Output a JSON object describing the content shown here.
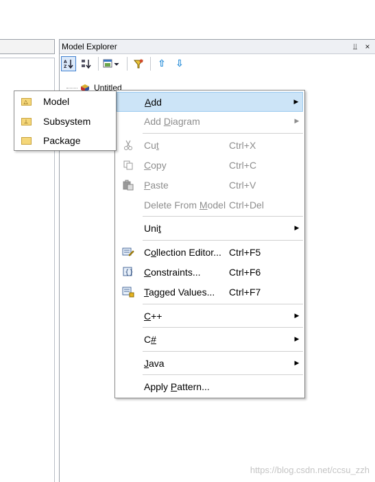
{
  "panel": {
    "title": "Model Explorer",
    "pin_glyph": "⫫",
    "close_glyph": "×"
  },
  "toolbar": {
    "sort_alpha_label": "a↓",
    "sort_type_label": "↓",
    "filter_label": "▼",
    "up_glyph": "⇧",
    "down_glyph": "⇩"
  },
  "tree": {
    "root_label": "Untitled"
  },
  "context_menu": {
    "items": [
      {
        "pre": "",
        "u": "A",
        "post": "dd",
        "shortcut": "",
        "submenu": true,
        "disabled": false
      },
      {
        "pre": "Add ",
        "u": "D",
        "post": "iagram",
        "shortcut": "",
        "submenu": true,
        "disabled": true
      },
      {
        "pre": "Cu",
        "u": "t",
        "post": "",
        "shortcut": "Ctrl+X",
        "submenu": false,
        "disabled": true
      },
      {
        "pre": "",
        "u": "C",
        "post": "opy",
        "shortcut": "Ctrl+C",
        "submenu": false,
        "disabled": true
      },
      {
        "pre": "",
        "u": "P",
        "post": "aste",
        "shortcut": "Ctrl+V",
        "submenu": false,
        "disabled": true
      },
      {
        "pre": "Delete From ",
        "u": "M",
        "post": "odel",
        "shortcut": "Ctrl+Del",
        "submenu": false,
        "disabled": true
      },
      {
        "pre": "Uni",
        "u": "t",
        "post": "",
        "shortcut": "",
        "submenu": true,
        "disabled": false
      },
      {
        "pre": "C",
        "u": "o",
        "post": "llection Editor...",
        "shortcut": "Ctrl+F5",
        "submenu": false,
        "disabled": false
      },
      {
        "pre": "",
        "u": "C",
        "post": "onstraints...",
        "shortcut": "Ctrl+F6",
        "submenu": false,
        "disabled": false
      },
      {
        "pre": "",
        "u": "T",
        "post": "agged Values...",
        "shortcut": "Ctrl+F7",
        "submenu": false,
        "disabled": false
      },
      {
        "pre": "",
        "u": "C",
        "post": "++",
        "shortcut": "",
        "submenu": true,
        "disabled": false
      },
      {
        "pre": "C",
        "u": "#",
        "post": "",
        "shortcut": "",
        "submenu": true,
        "disabled": false
      },
      {
        "pre": "",
        "u": "J",
        "post": "ava",
        "shortcut": "",
        "submenu": true,
        "disabled": false
      },
      {
        "pre": "Apply ",
        "u": "P",
        "post": "attern...",
        "shortcut": "",
        "submenu": false,
        "disabled": false
      }
    ],
    "submenu_arrow": "▶"
  },
  "add_submenu": {
    "items": [
      {
        "label": "Model",
        "icon": "model-folder-icon"
      },
      {
        "label": "Subsystem",
        "icon": "subsystem-folder-icon"
      },
      {
        "label": "Package",
        "icon": "package-folder-icon"
      }
    ]
  },
  "watermark": "https://blog.csdn.net/ccsu_zzh",
  "colors": {
    "highlight": "#cce4f7",
    "highlight_border": "#99c9ef",
    "disabled_text": "#8d8d8d",
    "accent_blue": "#1a86d6"
  }
}
